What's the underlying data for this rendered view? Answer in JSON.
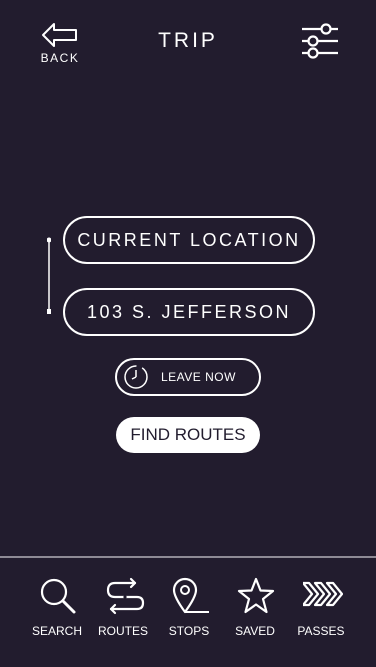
{
  "header": {
    "back_label": "BACK",
    "title": "TRIP",
    "back_icon": "arrow-left-icon",
    "filter_icon": "sliders-icon"
  },
  "trip": {
    "origin": "CURRENT LOCATION",
    "destination": "103 S. JEFFERSON",
    "leave_label": "LEAVE NOW",
    "leave_icon": "clock-icon",
    "find_label": "FIND ROUTES"
  },
  "tabs": [
    {
      "label": "SEARCH",
      "icon": "search-icon"
    },
    {
      "label": "ROUTES",
      "icon": "routes-icon"
    },
    {
      "label": "STOPS",
      "icon": "map-pin-icon"
    },
    {
      "label": "SAVED",
      "icon": "star-icon"
    },
    {
      "label": "PASSES",
      "icon": "double-chevron-right-icon"
    }
  ],
  "colors": {
    "background": "#221c2e",
    "foreground": "#ffffff",
    "divider": "#8e8a95"
  }
}
